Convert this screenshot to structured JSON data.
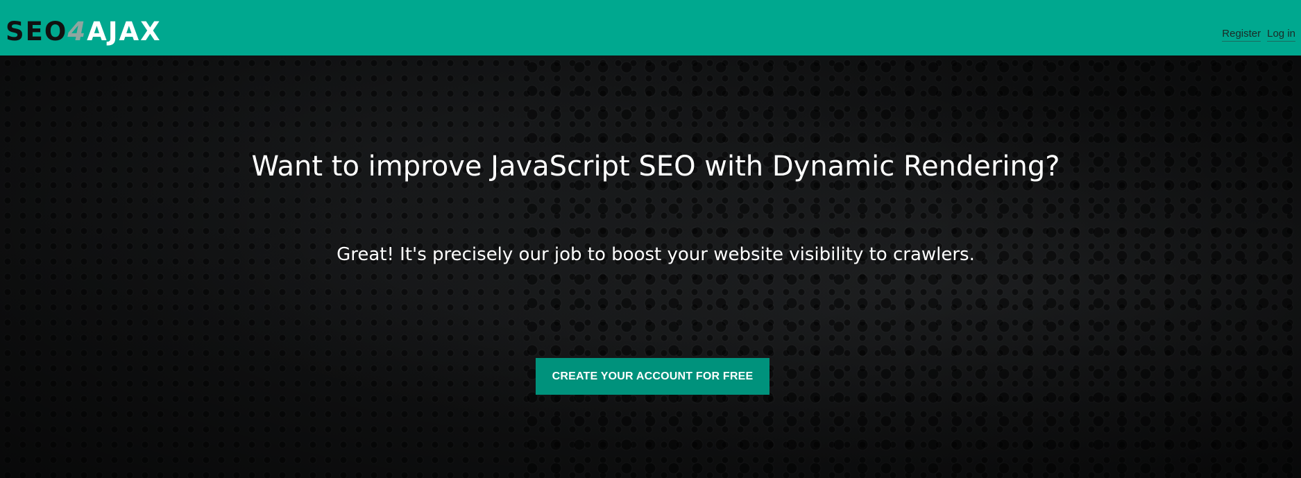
{
  "header": {
    "logo": {
      "part_a": "SEO",
      "part_b": "4",
      "part_c": "AJAX"
    },
    "nav": [
      {
        "label": "Register"
      },
      {
        "label": "Log in"
      }
    ]
  },
  "hero": {
    "headline": "Want to improve JavaScript SEO with Dynamic Rendering?",
    "subline": "Great! It's precisely our job to boost your website visibility to crawlers.",
    "cta_label": "CREATE YOUR ACCOUNT FOR FREE"
  },
  "colors": {
    "header_bg": "#00a88f",
    "cta_bg": "#00927c",
    "hero_bg": "#121314"
  }
}
